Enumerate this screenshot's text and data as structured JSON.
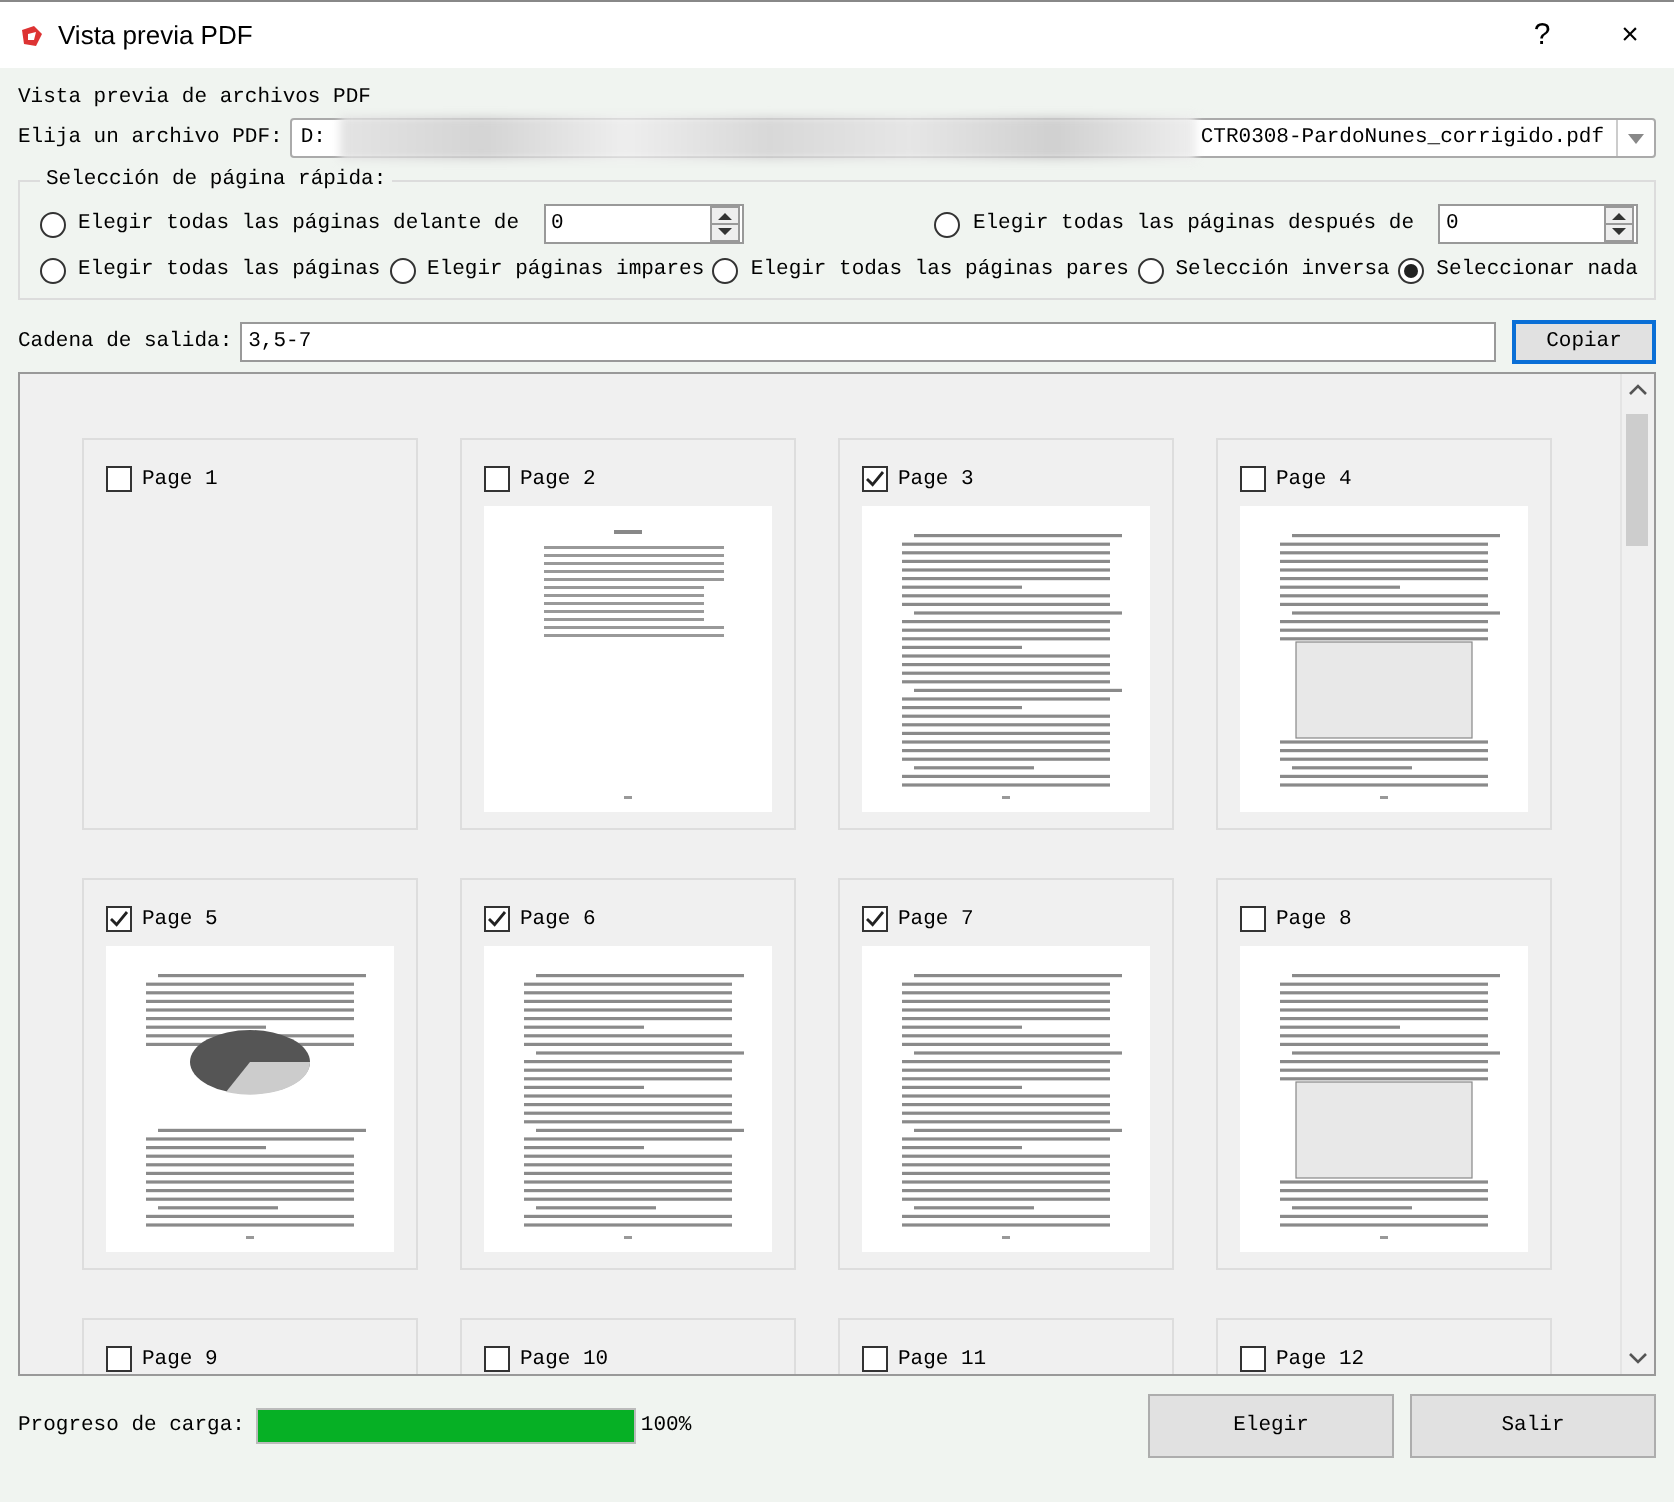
{
  "window": {
    "title": "Vista previa PDF",
    "help": "?",
    "close": "×"
  },
  "heading": "Vista previa de archivos PDF",
  "file": {
    "label": "Elija un archivo PDF:",
    "value_start": "D:",
    "value_end": "CTR0308-PardoNunes_corrigido.pdf"
  },
  "quick_selection": {
    "title": "Selección de página rápida:",
    "range_options": [
      {
        "label": "Elegir todas las páginas delante de",
        "selected": false,
        "spin_value": "0"
      },
      {
        "label": "Elegir todas las páginas después de",
        "selected": false,
        "spin_value": "0"
      }
    ],
    "options": [
      {
        "label": "Elegir todas las páginas",
        "selected": false
      },
      {
        "label": "Elegir páginas impares",
        "selected": false
      },
      {
        "label": "Elegir todas las páginas pares",
        "selected": false
      },
      {
        "label": "Selección inversa",
        "selected": false
      },
      {
        "label": "Seleccionar nada",
        "selected": true
      }
    ]
  },
  "output": {
    "label": "Cadena de salida:",
    "value": "3,5-7",
    "button": "Copiar"
  },
  "pages": [
    {
      "label": "Page 1",
      "checked": false,
      "has_preview": false
    },
    {
      "label": "Page 2",
      "checked": false,
      "has_preview": true
    },
    {
      "label": "Page 3",
      "checked": true,
      "has_preview": true
    },
    {
      "label": "Page 4",
      "checked": false,
      "has_preview": true
    },
    {
      "label": "Page 5",
      "checked": true,
      "has_preview": true
    },
    {
      "label": "Page 6",
      "checked": true,
      "has_preview": true
    },
    {
      "label": "Page 7",
      "checked": true,
      "has_preview": true
    },
    {
      "label": "Page 8",
      "checked": false,
      "has_preview": true
    },
    {
      "label": "Page 9",
      "checked": false
    },
    {
      "label": "Page 10",
      "checked": false
    },
    {
      "label": "Page 11",
      "checked": false
    },
    {
      "label": "Page 12",
      "checked": false
    }
  ],
  "progress": {
    "label": "Progreso de carga:",
    "level": 1,
    "reading": "100%"
  },
  "buttons": [
    "Elegir",
    "Salir"
  ]
}
